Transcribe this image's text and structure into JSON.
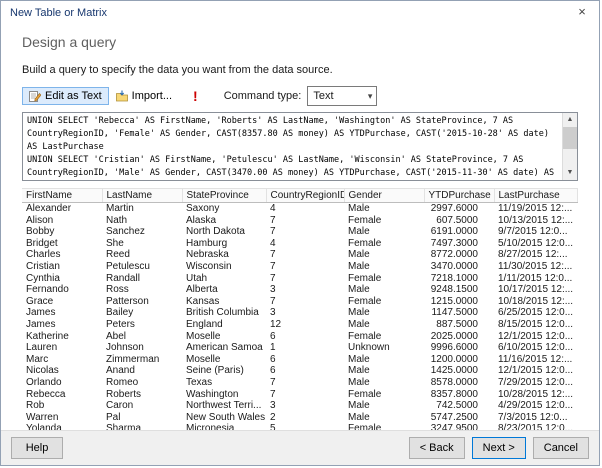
{
  "window": {
    "title": "New Table or Matrix",
    "close_icon": "×"
  },
  "header": {
    "title": "Design a query",
    "subtitle": "Build a query to specify the data you want from the data source."
  },
  "toolbar": {
    "edit_as_text": "Edit as Text",
    "import": "Import...",
    "run_icon": "!",
    "command_type_label": "Command type:",
    "command_type_value": "Text"
  },
  "icons": {
    "chevron_down": "▾",
    "scroll_up": "▲",
    "scroll_down": "▼"
  },
  "query": {
    "lines": [
      "UNION SELECT 'Rebecca' AS FirstName, 'Roberts' AS LastName, 'Washington' AS StateProvince, 7 AS",
      "CountryRegionID, 'Female' AS Gender, CAST(8357.80 AS money) AS YTDPurchase, CAST('2015-10-28' AS date)",
      "AS LastPurchase",
      "UNION SELECT 'Cristian' AS FirstName, 'Petulescu' AS LastName, 'Wisconsin' AS StateProvince, 7 AS",
      "CountryRegionID, 'Male' AS Gender, CAST(3470.00 AS money) AS YTDPurchase, CAST('2015-11-30' AS date) AS"
    ]
  },
  "grid": {
    "columns": [
      "FirstName",
      "LastName",
      "StateProvince",
      "CountryRegionID",
      "Gender",
      "YTDPurchase",
      "LastPurchase"
    ],
    "rows": [
      [
        "Alexander",
        "Martin",
        "Saxony",
        "4",
        "Male",
        "2997.6000",
        "11/19/2015 12:..."
      ],
      [
        "Alison",
        "Nath",
        "Alaska",
        "7",
        "Female",
        "607.5000",
        "10/13/2015 12:..."
      ],
      [
        "Bobby",
        "Sanchez",
        "North Dakota",
        "7",
        "Male",
        "6191.0000",
        "9/7/2015 12:0..."
      ],
      [
        "Bridget",
        "She",
        "Hamburg",
        "4",
        "Female",
        "7497.3000",
        "5/10/2015 12:0..."
      ],
      [
        "Charles",
        "Reed",
        "Nebraska",
        "7",
        "Male",
        "8772.0000",
        "8/27/2015 12:..."
      ],
      [
        "Cristian",
        "Petulescu",
        "Wisconsin",
        "7",
        "Male",
        "3470.0000",
        "11/30/2015 12:..."
      ],
      [
        "Cynthia",
        "Randall",
        "Utah",
        "7",
        "Female",
        "7218.1000",
        "1/11/2015 12:0..."
      ],
      [
        "Fernando",
        "Ross",
        "Alberta",
        "3",
        "Male",
        "9248.1500",
        "10/17/2015 12:..."
      ],
      [
        "Grace",
        "Patterson",
        "Kansas",
        "7",
        "Female",
        "1215.0000",
        "10/18/2015 12:..."
      ],
      [
        "James",
        "Bailey",
        "British Columbia",
        "3",
        "Male",
        "1147.5000",
        "6/25/2015 12:0..."
      ],
      [
        "James",
        "Peters",
        "England",
        "12",
        "Male",
        "887.5000",
        "8/15/2015 12:0..."
      ],
      [
        "Katherine",
        "Abel",
        "Moselle",
        "6",
        "Female",
        "2025.0000",
        "12/1/2015 12:0..."
      ],
      [
        "Lauren",
        "Johnson",
        "American Samoa",
        "1",
        "Unknown",
        "9996.6000",
        "6/10/2015 12:0..."
      ],
      [
        "Marc",
        "Zimmerman",
        "Moselle",
        "6",
        "Male",
        "1200.0000",
        "11/16/2015 12:..."
      ],
      [
        "Nicolas",
        "Anand",
        "Seine (Paris)",
        "6",
        "Male",
        "1425.0000",
        "12/1/2015 12:0..."
      ],
      [
        "Orlando",
        "Romeo",
        "Texas",
        "7",
        "Male",
        "8578.0000",
        "7/29/2015 12:0..."
      ],
      [
        "Rebecca",
        "Roberts",
        "Washington",
        "7",
        "Female",
        "8357.8000",
        "10/28/2015 12:..."
      ],
      [
        "Rob",
        "Caron",
        "Northwest Terri...",
        "3",
        "Male",
        "742.5000",
        "4/29/2015 12:0..."
      ],
      [
        "Warren",
        "Pal",
        "New South Wales",
        "2",
        "Male",
        "5747.2500",
        "7/3/2015 12:0..."
      ],
      [
        "Yolanda",
        "Sharma",
        "Micronesia",
        "5",
        "Female",
        "3247.9500",
        "8/23/2015 12:0..."
      ]
    ]
  },
  "footer": {
    "help": "Help",
    "back": "< Back",
    "next": "Next >",
    "cancel": "Cancel"
  }
}
